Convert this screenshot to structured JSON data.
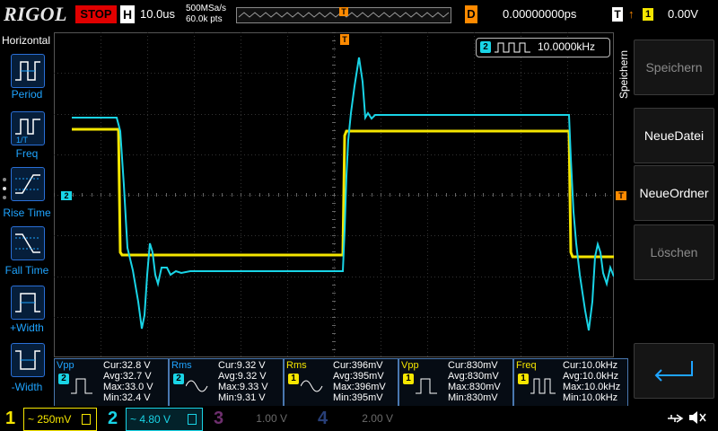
{
  "header": {
    "logo": "RIGOL",
    "run_state": "STOP",
    "timebase_label": "H",
    "timebase_value": "10.0us",
    "sample_rate": "500MSa/s",
    "points": "60.0k pts",
    "trigger_marker": "T",
    "delay_label": "D",
    "delay_value": "0.00000000ps",
    "trigger_label": "T",
    "trigger_slope": "↑",
    "trigger_source": "1",
    "trigger_level": "0.00V"
  },
  "left_panel": {
    "title": "Horizontal",
    "buttons": [
      {
        "label": "Period",
        "icon": "period-icon"
      },
      {
        "label": "Freq",
        "icon": "frequency-icon"
      },
      {
        "label": "Rise Time",
        "icon": "rise-time-icon"
      },
      {
        "label": "Fall Time",
        "icon": "fall-time-icon"
      },
      {
        "label": "+Width",
        "icon": "positive-width-icon"
      },
      {
        "label": "-Width",
        "icon": "negative-width-icon"
      }
    ]
  },
  "graticule": {
    "ch2_ground_marker": "2",
    "trigger_level_marker": "T",
    "trigger_pos_marker": "T",
    "freq_counter_channel": "2",
    "freq_counter_value": "10.0000kHz"
  },
  "right_panel": {
    "caption": "Speichern",
    "softkeys": [
      {
        "label": "Speichern",
        "enabled": false
      },
      {
        "label": "NeueDatei",
        "enabled": true
      },
      {
        "label": "NeueOrdner",
        "enabled": true
      },
      {
        "label": "Löschen",
        "enabled": false
      },
      {
        "label": "",
        "enabled": true,
        "icon": "enter-arrow-icon"
      }
    ]
  },
  "measurements": [
    {
      "name": "Vpp",
      "source": "2",
      "cur": "Cur:32.8 V",
      "avg": "Avg:32.7 V",
      "max": "Max:33.0 V",
      "min": "Min:32.4 V"
    },
    {
      "name": "Rms",
      "source": "2",
      "cur": "Cur:9.32 V",
      "avg": "Avg:9.32 V",
      "max": "Max:9.33 V",
      "min": "Min:9.31 V"
    },
    {
      "name": "Rms",
      "source": "1",
      "cur": "Cur:396mV",
      "avg": "Avg:395mV",
      "max": "Max:396mV",
      "min": "Min:395mV"
    },
    {
      "name": "Vpp",
      "source": "1",
      "cur": "Cur:830mV",
      "avg": "Avg:830mV",
      "max": "Max:830mV",
      "min": "Min:830mV"
    },
    {
      "name": "Freq",
      "source": "1",
      "cur": "Cur:10.0kHz",
      "avg": "Avg:10.0kHz",
      "max": "Max:10.0kHz",
      "min": "Min:10.0kHz"
    }
  ],
  "channels": [
    {
      "num": "1",
      "scale": "~ 250mV",
      "color": "#f5e600",
      "active": true
    },
    {
      "num": "2",
      "scale": "~ 4.80 V",
      "color": "#19d4e6",
      "active": true
    },
    {
      "num": "3",
      "scale": "1.00 V",
      "color": "#d84fd8",
      "active": false
    },
    {
      "num": "4",
      "scale": "2.00 V",
      "color": "#3a6fe0",
      "active": false
    }
  ],
  "status_icons": [
    "usb-icon",
    "speaker-muted-icon"
  ],
  "colors": {
    "ch1": "#f5e600",
    "ch2": "#19d4e6",
    "trigger": "#ff8a00",
    "accent": "#1fa4ff",
    "stop": "#e00000"
  }
}
